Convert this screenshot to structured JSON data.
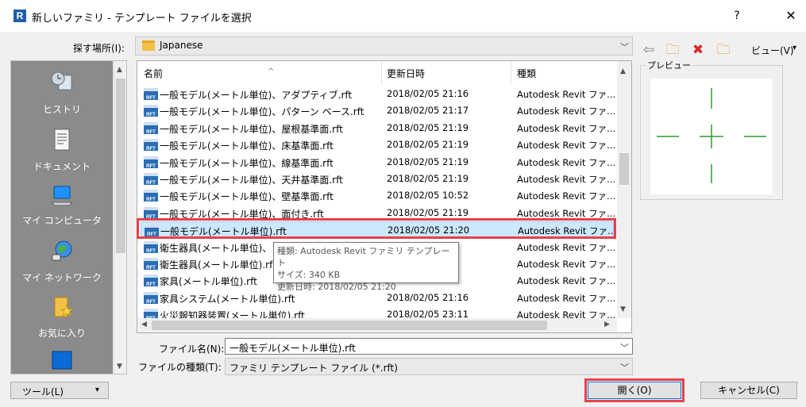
{
  "window": {
    "app_icon_letter": "R",
    "title": "新しいファミリ - テンプレート ファイルを選択",
    "help": "?",
    "close": "✕"
  },
  "lookin": {
    "label": "探す場所(I):",
    "value": "Japanese"
  },
  "toolbar": {
    "back": "⇦",
    "up": "🗀",
    "delete": "✖",
    "new_folder": "🗀",
    "views_label": "ビュー(V)",
    "views_arrow": "▾"
  },
  "places": [
    {
      "label": "ヒストリ",
      "icon": "history-icon"
    },
    {
      "label": "ドキュメント",
      "icon": "documents-icon"
    },
    {
      "label": "マイ コンピュータ",
      "icon": "computer-icon"
    },
    {
      "label": "マイ ネットワーク",
      "icon": "network-icon"
    },
    {
      "label": "お気に入り",
      "icon": "favorites-icon"
    },
    {
      "label": "",
      "icon": "desktop-icon"
    }
  ],
  "columns": {
    "name": "名前",
    "date": "更新日時",
    "type": "種類"
  },
  "files": [
    {
      "name": "一般モデル(メートル単位)、アダプティブ.rft",
      "date": "2018/02/05 21:16",
      "type": "Autodesk Revit ファ..."
    },
    {
      "name": "一般モデル(メートル単位)、パターン ベース.rft",
      "date": "2018/02/05 21:17",
      "type": "Autodesk Revit ファ..."
    },
    {
      "name": "一般モデル(メートル単位)、屋根基準面.rft",
      "date": "2018/02/05 21:19",
      "type": "Autodesk Revit ファ..."
    },
    {
      "name": "一般モデル(メートル単位)、床基準面.rft",
      "date": "2018/02/05 21:19",
      "type": "Autodesk Revit ファ..."
    },
    {
      "name": "一般モデル(メートル単位)、線基準面.rft",
      "date": "2018/02/05 21:19",
      "type": "Autodesk Revit ファ..."
    },
    {
      "name": "一般モデル(メートル単位)、天井基準面.rft",
      "date": "2018/02/05 21:19",
      "type": "Autodesk Revit ファ..."
    },
    {
      "name": "一般モデル(メートル単位)、壁基準面.rft",
      "date": "2018/02/05 10:52",
      "type": "Autodesk Revit ファ..."
    },
    {
      "name": "一般モデル(メートル単位)、面付き.rft",
      "date": "2018/02/05 21:19",
      "type": "Autodesk Revit ファ..."
    },
    {
      "name": "一般モデル(メートル単位).rft",
      "date": "2018/02/05 21:20",
      "type": "Autodesk Revit ファ..."
    },
    {
      "name": "衛生器具(メートル単位)、",
      "date": "2",
      "type": "Autodesk Revit ファ..."
    },
    {
      "name": "衛生器具(メートル単位).rf",
      "date": "1",
      "type": "Autodesk Revit ファ..."
    },
    {
      "name": "家具(メートル単位).rft",
      "date": "0",
      "type": "Autodesk Revit ファ..."
    },
    {
      "name": "家具システム(メートル単位).rft",
      "date": "2018/02/05 21:16",
      "type": "Autodesk Revit ファ..."
    },
    {
      "name": "火災報知器装置(メートル単位).rft",
      "date": "2018/02/05 23:11",
      "type": "Autodesk Revit ファ..."
    }
  ],
  "selected_index": 8,
  "rft_badge": "RFT",
  "tooltip": {
    "line1": "種類: Autodesk Revit ファミリ テンプレート",
    "line2": "サイズ: 340 KB",
    "line3": "更新日時: 2018/02/05 21:20"
  },
  "preview": {
    "label": "プレビュー",
    "crosshair_color": "#2e9a2e"
  },
  "filename": {
    "label": "ファイル名(N):",
    "value": "一般モデル(メートル単位).rft"
  },
  "filetype": {
    "label": "ファイルの種類(T):",
    "value": "ファミリ テンプレート ファイル (*.rft)"
  },
  "buttons": {
    "tools": "ツール(L)",
    "tools_arrow": "▾",
    "open": "開く(O)",
    "cancel": "キャンセル(C)"
  },
  "colors": {
    "highlight_border": "#e8404a",
    "selection_bg": "#cce8ff"
  }
}
